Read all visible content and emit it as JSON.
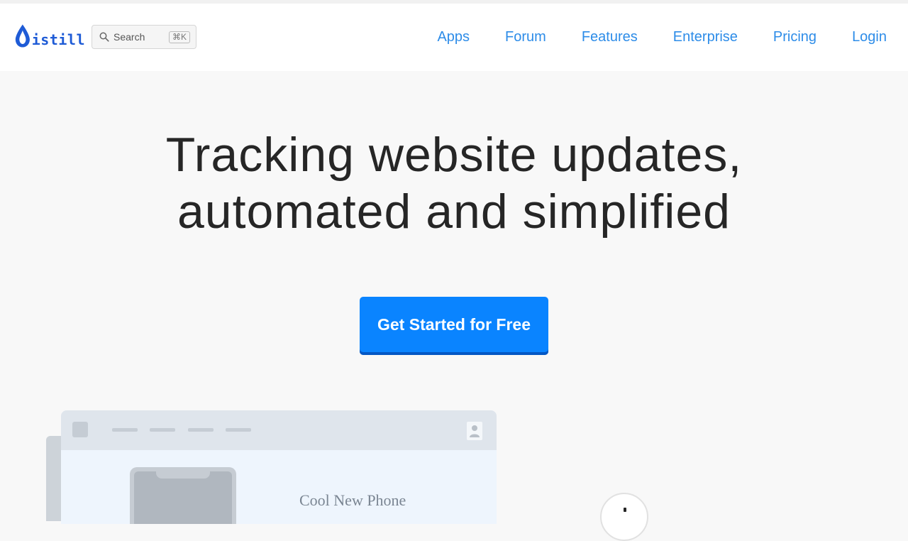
{
  "brand": {
    "name": "istill",
    "color": "#1e5bd6"
  },
  "search": {
    "placeholder": "Search",
    "shortcut": "⌘K"
  },
  "nav": {
    "items": [
      {
        "label": "Apps"
      },
      {
        "label": "Forum"
      },
      {
        "label": "Features"
      },
      {
        "label": "Enterprise"
      },
      {
        "label": "Pricing"
      },
      {
        "label": "Login"
      }
    ],
    "color": "#2d8ce8"
  },
  "hero": {
    "title_line1": "Tracking website updates,",
    "title_line2": "automated and simplified",
    "cta_label": "Get Started for Free",
    "cta_color": "#0a84ff"
  },
  "illustration": {
    "product_title": "Cool New Phone"
  }
}
